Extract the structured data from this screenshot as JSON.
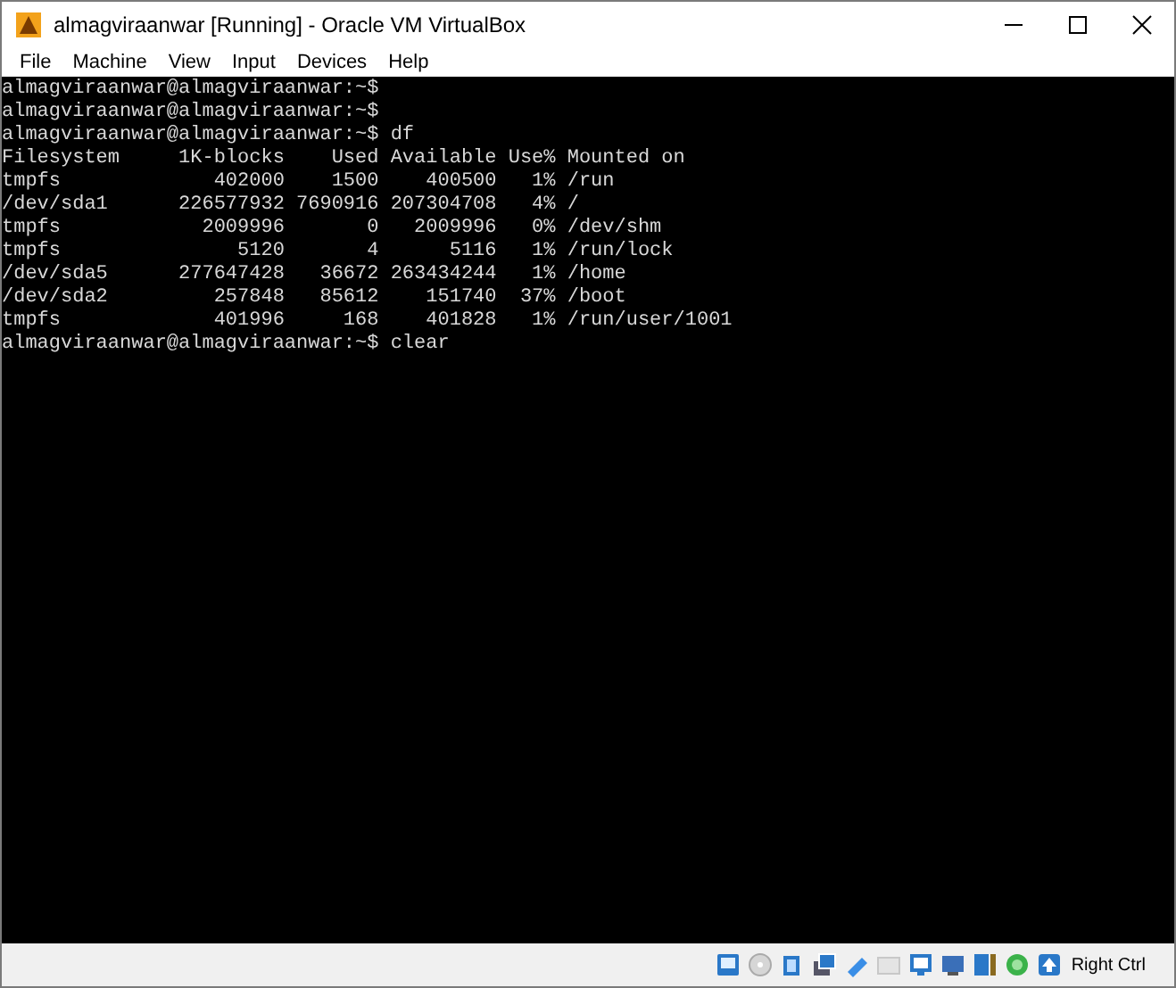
{
  "window": {
    "title": "almagviraanwar [Running] - Oracle VM VirtualBox"
  },
  "menu": [
    "File",
    "Machine",
    "View",
    "Input",
    "Devices",
    "Help"
  ],
  "terminal": {
    "lines": [
      "almagviraanwar@almagviraanwar:~$",
      "almagviraanwar@almagviraanwar:~$",
      "almagviraanwar@almagviraanwar:~$ df",
      "Filesystem     1K-blocks    Used Available Use% Mounted on",
      "tmpfs             402000    1500    400500   1% /run",
      "/dev/sda1      226577932 7690916 207304708   4% /",
      "tmpfs            2009996       0   2009996   0% /dev/shm",
      "tmpfs               5120       4      5116   1% /run/lock",
      "/dev/sda5      277647428   36672 263434244   1% /home",
      "/dev/sda2         257848   85612    151740  37% /boot",
      "tmpfs             401996     168    401828   1% /run/user/1001",
      "almagviraanwar@almagviraanwar:~$ clear"
    ]
  },
  "status_bar": {
    "host_key": "Right Ctrl"
  }
}
